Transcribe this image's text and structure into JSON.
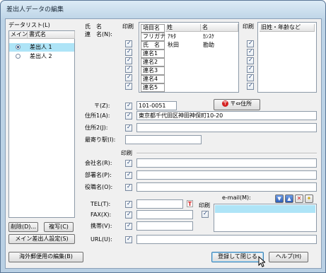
{
  "window": {
    "title": "差出人データの編集"
  },
  "data_list": {
    "label": "データリスト(L)",
    "col_main": "メイン",
    "col_name": "書式名",
    "items": [
      {
        "name": "差出人 1",
        "selected": true
      },
      {
        "name": "差出人 2",
        "selected": false
      }
    ],
    "delete_label": "削除(D)...",
    "copy_label": "複写(C)",
    "main_setting_label": "メイン差出人設定(S)"
  },
  "name_table": {
    "label_line1": "氏　名",
    "label_line2": "連　名(N):",
    "print_header": "印刷",
    "header": {
      "item": "項目名",
      "last": "姓",
      "first": "名"
    },
    "rows": [
      {
        "item": "フリガナ",
        "last": "ｱｷﾀ",
        "first": "ｶﾝｽｹ"
      },
      {
        "item": "氏　名",
        "last": "秋田",
        "first": "勘助"
      },
      {
        "item": "連名1",
        "last": "",
        "first": ""
      },
      {
        "item": "連名2",
        "last": "",
        "first": ""
      },
      {
        "item": "連名3",
        "last": "",
        "first": ""
      },
      {
        "item": "連名4",
        "last": "",
        "first": ""
      },
      {
        "item": "連名5",
        "last": "",
        "first": ""
      }
    ],
    "right_print_header": "印刷",
    "old_name_header": "旧姓・年齢など"
  },
  "address": {
    "zip_label": "〒(Z):",
    "zip_value": "101-0051",
    "zip_convert_label": "〒⇔住所",
    "addr1_label": "住所1(A):",
    "addr1_value": "東京都千代田区神田神保町10-20",
    "addr2_label": "住所2(J):",
    "addr2_value": "",
    "station_label": "最寄り駅(I):",
    "station_value": ""
  },
  "company": {
    "print_header": "印刷",
    "company_label": "会社名(R):",
    "dept_label": "部署名(P):",
    "title_label": "役職名(O):"
  },
  "contact": {
    "tel_label": "TEL(T):",
    "fax_label": "FAX(X):",
    "mobile_label": "携帯(V):",
    "url_label": "URL(U):",
    "print_label": "印刷",
    "email_label": "e-mail(M):"
  },
  "buttons": {
    "overseas_label": "海外郵便用の編集(B)",
    "save_close_label": "登録して閉じる",
    "help_label": "ヘルプ(H)"
  }
}
